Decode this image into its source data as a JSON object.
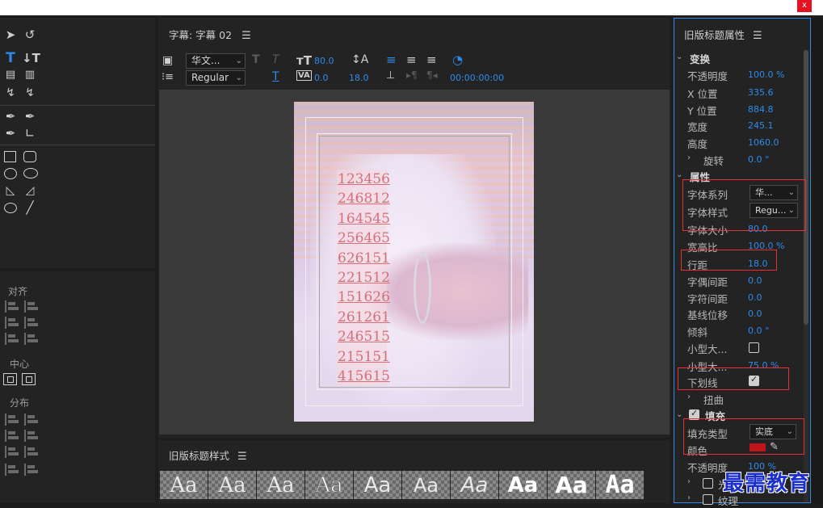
{
  "window": {
    "close_label": "x"
  },
  "title_panel": {
    "tab_label": "字幕: 字幕 02",
    "font_family": "华文...",
    "font_style": "Regular",
    "font_size": "80.0",
    "kerning": "0.0",
    "leading": "18.0",
    "timecode": "00:00:00:00"
  },
  "canvas": {
    "numbers": [
      "123456",
      "246812",
      "164545",
      "256465",
      "626151",
      "221512",
      "151626",
      "261261",
      "246515",
      "215151",
      "415615"
    ]
  },
  "align_panel": {
    "align_label": "对齐",
    "center_label": "中心",
    "distribute_label": "分布"
  },
  "styles_panel": {
    "title": "旧版标题样式",
    "swatch_text": "Aa"
  },
  "properties": {
    "title": "旧版标题属性",
    "transform": {
      "label": "变换",
      "opacity_label": "不透明度",
      "opacity": "100.0 %",
      "x_label": "X 位置",
      "x": "335.6",
      "y_label": "Y 位置",
      "y": "884.8",
      "width_label": "宽度",
      "width": "245.1",
      "height_label": "高度",
      "height": "1060.0",
      "rotation_label": "旋转",
      "rotation": "0.0 °"
    },
    "attributes": {
      "label": "属性",
      "font_family_label": "字体系列",
      "font_family": "华...",
      "font_style_label": "字体样式",
      "font_style": "Regu...",
      "font_size_label": "字体大小",
      "font_size": "80.0",
      "aspect_label": "宽高比",
      "aspect": "100.0 %",
      "leading_label": "行距",
      "leading": "18.0",
      "kerning_label": "字偶间距",
      "kerning": "0.0",
      "tracking_label": "字符间距",
      "tracking": "0.0",
      "baseline_label": "基线位移",
      "baseline": "0.0",
      "slant_label": "倾斜",
      "slant": "0.0 °",
      "smallcaps_label": "小型大...",
      "smallcaps_size_label": "小型大...",
      "smallcaps_size": "75.0 %",
      "underline_label": "下划线",
      "distort_label": "扭曲"
    },
    "fill": {
      "label": "填充",
      "type_label": "填充类型",
      "type": "实底",
      "color_label": "颜色",
      "color": "#c0141c",
      "opacity_label": "不透明度",
      "opacity": "100 %",
      "sheen_label": "光泽",
      "texture_label": "纹理"
    }
  },
  "watermark": "最需教育"
}
